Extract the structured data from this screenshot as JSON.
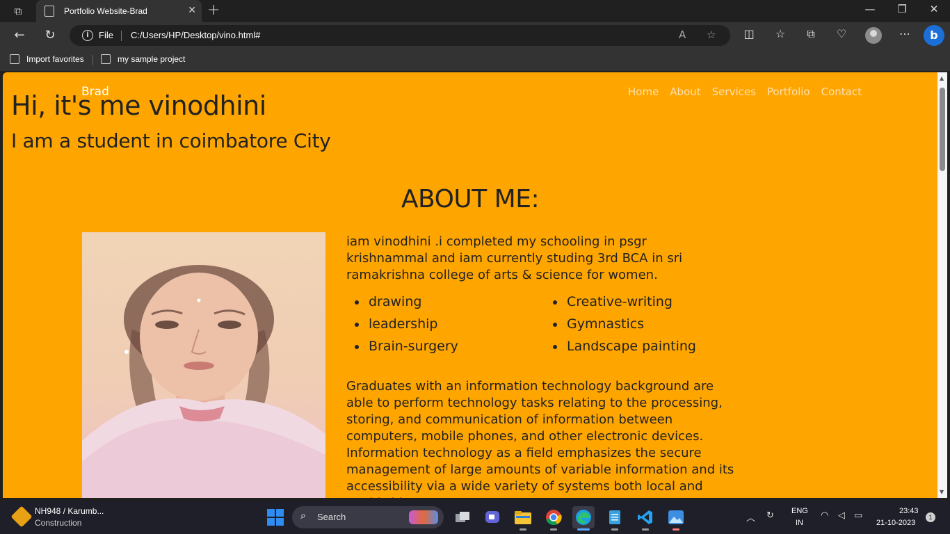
{
  "browser": {
    "tab_title": "Portfolio Website-Brad",
    "address_protocol": "File",
    "url": "C:/Users/HP/Desktop/vino.html#",
    "favorites": [
      {
        "label": "Import favorites",
        "icon": "import-icon"
      },
      {
        "label": "my sample project",
        "icon": "page-icon"
      }
    ]
  },
  "site": {
    "logo": "Brad",
    "nav": [
      "Home",
      "About",
      "Services",
      "Portfolio",
      "Contact"
    ],
    "hero_title": "Hi, it's me vinodhini",
    "hero_subtitle": "I am a student in coimbatore City",
    "about_heading": "ABOUT ME:",
    "about_text": "iam vinodhini .i completed my schooling in psgr krishnammal and iam currently studing 3rd BCA in sri ramakrishna college of arts & science for women.",
    "skills": [
      "drawing",
      "Creative-writing",
      "leadership",
      "Gymnastics",
      "Brain-surgery",
      "Landscape painting"
    ],
    "it_text": "Graduates with an information technology background are able to perform technology tasks relating to the processing, storing, and communication of information between computers, mobile phones, and other electronic devices. Information technology as a field emphasizes the secure management of large amounts of variable information and its accessibility via a wide variety of systems both local and worldwide.",
    "colors": {
      "background": "#ffa500",
      "text": "#222222",
      "logo": "#ffffff",
      "nav_link": "#ffe0b0"
    }
  },
  "taskbar": {
    "widget_title": "NH948 / Karumb...",
    "widget_subtitle": "Construction",
    "search_label": "Search",
    "lang_line1": "ENG",
    "lang_line2": "IN",
    "time": "23:43",
    "date": "21-10-2023",
    "notification_count": "1"
  }
}
